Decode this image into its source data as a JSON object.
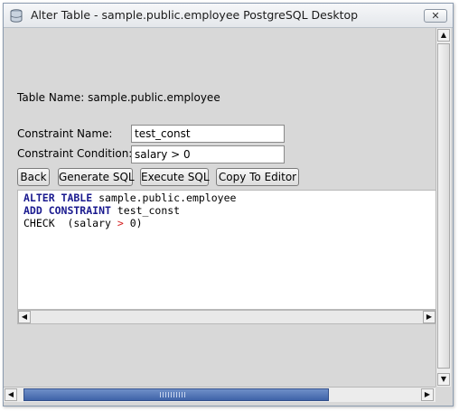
{
  "window": {
    "title": "Alter Table - sample.public.employee PostgreSQL Desktop",
    "close_glyph": "✕"
  },
  "table_name_label": "Table Name: sample.public.employee",
  "form": {
    "constraint_name_label": "Constraint Name:",
    "constraint_name_value": "test_const",
    "constraint_condition_label": "Constraint Condition:",
    "constraint_condition_value": "salary > 0"
  },
  "buttons": {
    "back": "Back",
    "generate_sql": "Generate SQL",
    "execute_sql": "Execute SQL",
    "copy_to_editor": "Copy To Editor"
  },
  "sql": {
    "line1_kw": "ALTER TABLE",
    "line1_rest": " sample.public.employee",
    "line2_kw": "ADD CONSTRAINT",
    "line2_rest": " test_const",
    "line3_a": "CHECK  (salary ",
    "line3_op": ">",
    "line3_b": " 0)"
  },
  "icons": {
    "app": "database-icon",
    "close": "close-icon",
    "left": "arrow-left-icon",
    "right": "arrow-right-icon",
    "up": "arrow-up-icon",
    "down": "arrow-down-icon"
  },
  "colors": {
    "keyword": "#1a1a8f",
    "operator": "#d42020",
    "scroll_thumb": "#3f63a8"
  }
}
